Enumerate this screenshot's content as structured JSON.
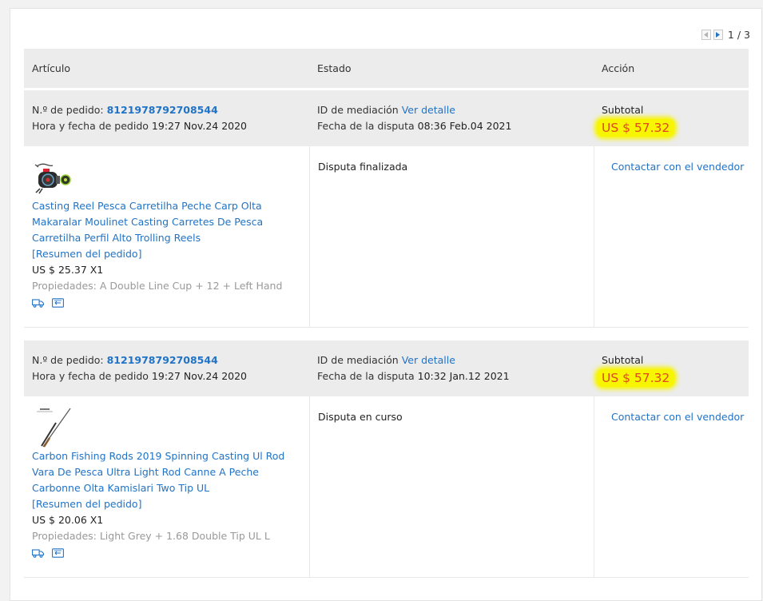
{
  "pagination": {
    "text": "1 / 3"
  },
  "table_header": {
    "item": "Artículo",
    "status": "Estado",
    "action": "Acción"
  },
  "orders": [
    {
      "order_label": "N.º de pedido:",
      "order_id": "8121978792708544",
      "order_date_label": "Hora y fecha de pedido",
      "order_date": "19:27 Nov.24 2020",
      "mediation_label": "ID de mediación",
      "mediation_link": "Ver detalle",
      "dispute_date_label": "Fecha de la disputa",
      "dispute_date": "08:36 Feb.04 2021",
      "subtotal_label": "Subtotal",
      "subtotal": "US $ 57.32",
      "product_title": "Casting Reel Pesca Carretilha Peche Carp Olta Makaralar Moulinet Casting Carretes De Pesca Carretilha Perfil Alto Trolling Reels",
      "summary_link": "[Resumen del pedido]",
      "price_qty": "US $ 25.37 X1",
      "properties": "Propiedades: A Double Line Cup + 12 + Left Hand",
      "status": "Disputa finalizada",
      "contact": "Contactar con el vendedor"
    },
    {
      "order_label": "N.º de pedido:",
      "order_id": "8121978792708544",
      "order_date_label": "Hora y fecha de pedido",
      "order_date": "19:27 Nov.24 2020",
      "mediation_label": "ID de mediación",
      "mediation_link": "Ver detalle",
      "dispute_date_label": "Fecha de la disputa",
      "dispute_date": "10:32 Jan.12 2021",
      "subtotal_label": "Subtotal",
      "subtotal": "US $ 57.32",
      "product_title": "Carbon Fishing Rods 2019 Spinning Casting Ul Rod Vara De Pesca Ultra Light Rod Canne A Peche Carbonne Olta Kamislari Two Tip UL",
      "summary_link": "[Resumen del pedido]",
      "price_qty": "US $ 20.06 X1",
      "properties": "Propiedades: Light Grey + 1.68 Double Tip UL L",
      "status": "Disputa en curso",
      "contact": "Contactar con el vendedor"
    }
  ],
  "colors": {
    "link": "#2173c6",
    "price": "#e0491e",
    "highlight": "#f7f500",
    "header_bg": "#ececec"
  },
  "icons": [
    "chevron-left-icon",
    "chevron-right-icon",
    "shipping-truck-icon",
    "order-return-icon",
    "fishing-reel-thumbnail",
    "fishing-rod-thumbnail"
  ]
}
